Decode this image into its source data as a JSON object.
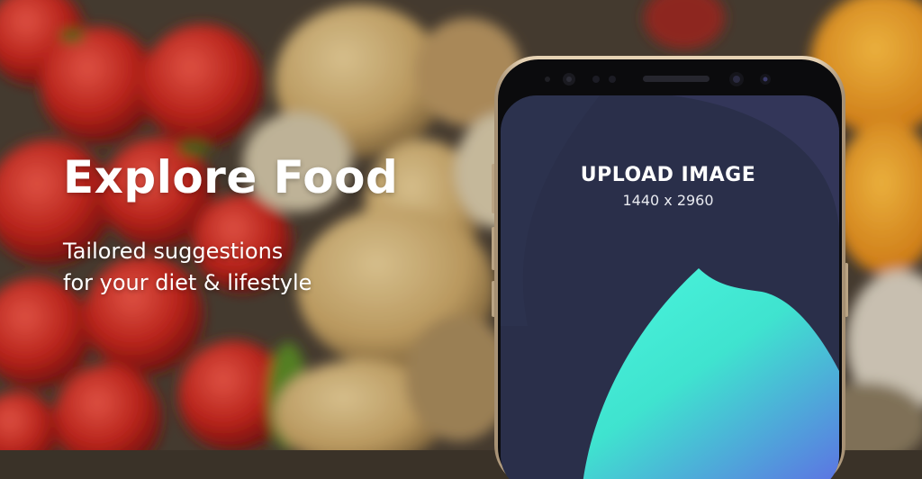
{
  "promo": {
    "headline": "Explore Food",
    "tagline_line1": "Tailored suggestions",
    "tagline_line2": "for your diet & lifestyle"
  },
  "phone_screen": {
    "upload_title": "UPLOAD IMAGE",
    "upload_dimensions": "1440 x 2960"
  },
  "colors": {
    "screen_background": "#2a2f4a",
    "blob_gradient_start": "#3ef0d8",
    "blob_gradient_end": "#5a7ae0",
    "phone_frame": "#d9c3a5"
  }
}
